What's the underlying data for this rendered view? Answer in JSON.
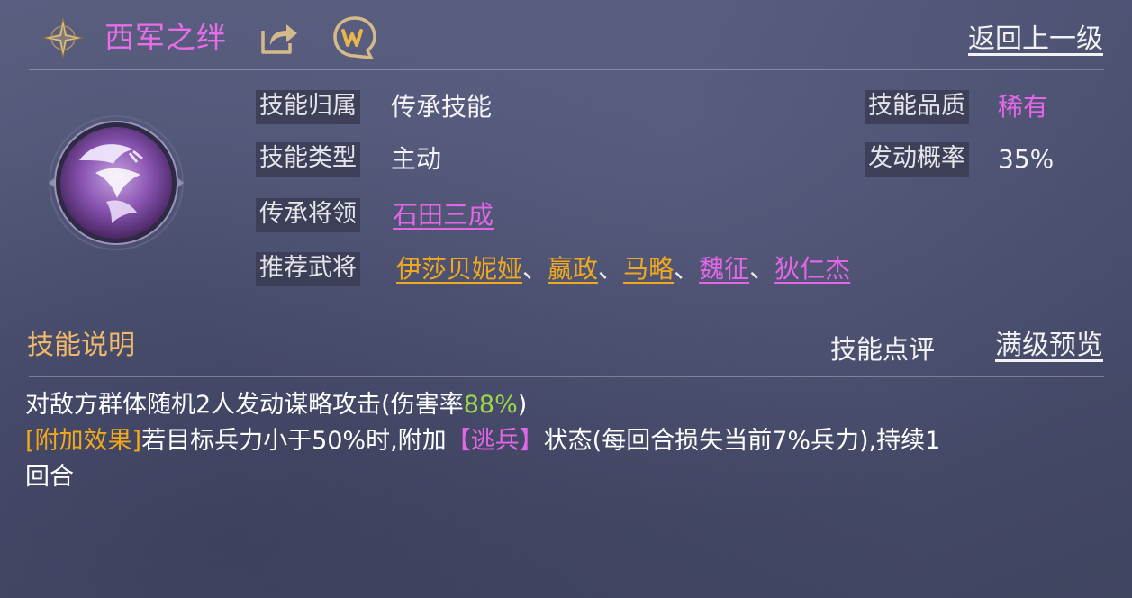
{
  "header": {
    "title": "西军之绊",
    "back_label": "返回上一级"
  },
  "icons": {
    "star": "star-compass-icon",
    "share": "share-icon",
    "wechat": "wechat-icon",
    "emblem": "skill-emblem-icon"
  },
  "info": {
    "ownership_label": "技能归属",
    "ownership_value": "传承技能",
    "type_label": "技能类型",
    "type_value": "主动",
    "inherit_label": "传承将领",
    "inherit_value": "石田三成",
    "recommend_label": "推荐武将",
    "recommend_generals": [
      {
        "name": "伊莎贝妮娅",
        "color": "#f0a91c"
      },
      {
        "name": "嬴政",
        "color": "#f0a91c"
      },
      {
        "name": "马略",
        "color": "#f0a91c"
      },
      {
        "name": "魏征",
        "color": "#e366e6"
      },
      {
        "name": "狄仁杰",
        "color": "#e366e6"
      }
    ],
    "separator": "、",
    "quality_label": "技能品质",
    "quality_value": "稀有",
    "rate_label": "发动概率",
    "rate_value": "35%"
  },
  "section": {
    "title": "技能说明",
    "review_label": "技能点评",
    "preview_label": "满级预览"
  },
  "description": {
    "line1_pre": "对敌方群体随机2人发动谋略攻击(伤害率",
    "line1_rate": "88%",
    "line1_post": ")",
    "line2_tag": "[附加效果]",
    "line2_pre": "若目标兵力小于50%时,附加",
    "line2_status": "【逃兵】",
    "line2_post": "状态(每回合损失当前7%兵力),持续1",
    "line3": "回合"
  },
  "colors": {
    "title": "#e86de8",
    "purple": "#e366e6",
    "orange": "#f0a91c",
    "green": "#9bd64a",
    "section_title": "#f0b96a"
  }
}
